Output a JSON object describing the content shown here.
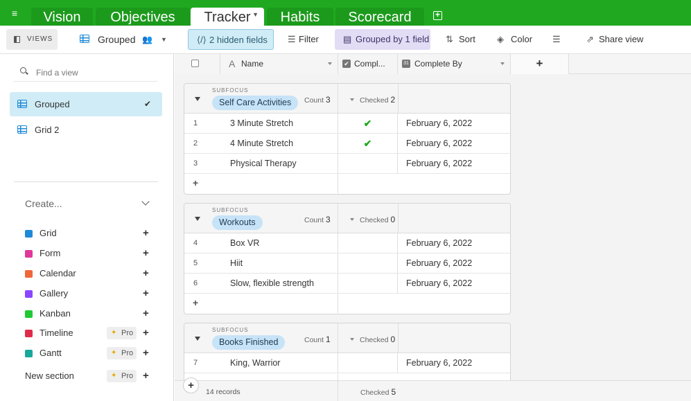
{
  "tabs": [
    {
      "label": "Vision"
    },
    {
      "label": "Objectives"
    },
    {
      "label": "Tracker"
    },
    {
      "label": "Habits"
    },
    {
      "label": "Scorecard"
    }
  ],
  "toolbar": {
    "views_label": "VIEWS",
    "view_name": "Grouped",
    "hidden_fields": "2 hidden fields",
    "filter": "Filter",
    "grouped": "Grouped by 1 field",
    "sort": "Sort",
    "color": "Color",
    "share": "Share view"
  },
  "sidebar": {
    "find_placeholder": "Find a view",
    "views": [
      {
        "label": "Grouped",
        "active": true
      },
      {
        "label": "Grid 2",
        "active": false
      }
    ],
    "create_label": "Create...",
    "create_items": [
      {
        "label": "Grid",
        "color": "#1f8ad8"
      },
      {
        "label": "Form",
        "color": "#e0389a"
      },
      {
        "label": "Calendar",
        "color": "#f0673a"
      },
      {
        "label": "Gallery",
        "color": "#8b46ff"
      },
      {
        "label": "Kanban",
        "color": "#20c933"
      },
      {
        "label": "Timeline",
        "color": "#e02c4a",
        "pro": "Pro"
      },
      {
        "label": "Gantt",
        "color": "#18a89a",
        "pro": "Pro"
      }
    ],
    "new_section": "New section",
    "new_section_pro": "Pro"
  },
  "grid": {
    "columns": {
      "name": "Name",
      "complete": "Compl...",
      "complete_by": "Complete By"
    },
    "groups": [
      {
        "sublabel": "SUBFOCUS",
        "name": "Self Care Activities",
        "count_label": "Count",
        "count": "3",
        "checked_label": "Checked",
        "checked": "2",
        "rows": [
          {
            "num": "1",
            "name": "3 Minute Stretch",
            "checked": "✔",
            "date": "February 6, 2022"
          },
          {
            "num": "2",
            "name": "4 Minute Stretch",
            "checked": "✔",
            "date": "February 6, 2022"
          },
          {
            "num": "3",
            "name": "Physical Therapy",
            "checked": "",
            "date": "February 6, 2022"
          }
        ]
      },
      {
        "sublabel": "SUBFOCUS",
        "name": "Workouts",
        "count_label": "Count",
        "count": "3",
        "checked_label": "Checked",
        "checked": "0",
        "rows": [
          {
            "num": "4",
            "name": "Box VR",
            "checked": "",
            "date": "February 6, 2022"
          },
          {
            "num": "5",
            "name": "Hiit",
            "checked": "",
            "date": "February 6, 2022"
          },
          {
            "num": "6",
            "name": "Slow, flexible strength",
            "checked": "",
            "date": "February 6, 2022"
          }
        ]
      },
      {
        "sublabel": "SUBFOCUS",
        "name": "Books Finished",
        "count_label": "Count",
        "count": "1",
        "checked_label": "Checked",
        "checked": "0",
        "rows": [
          {
            "num": "7",
            "name": "King, Warrior",
            "checked": "",
            "date": "February 6, 2022"
          }
        ]
      }
    ],
    "footer": {
      "records": "14 records",
      "checked_label": "Checked",
      "checked": "5"
    }
  }
}
